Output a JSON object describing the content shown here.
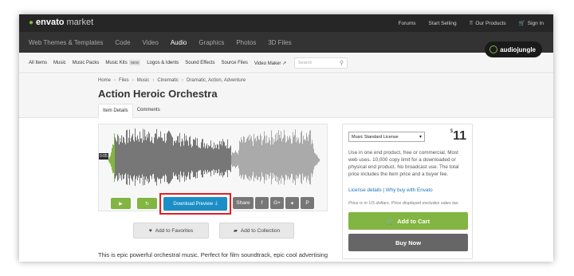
{
  "topbar": {
    "logo_brand": "envato",
    "logo_suffix": "market",
    "links": {
      "forums": "Forums",
      "start_selling": "Start Selling",
      "our_products": "Our Products",
      "sign_in": "Sign In"
    }
  },
  "navbar": {
    "items": [
      "Web Themes & Templates",
      "Code",
      "Video",
      "Audio",
      "Graphics",
      "Photos",
      "3D Files"
    ],
    "active": "Audio",
    "badge": "audiojungle"
  },
  "subnav": {
    "items": [
      "All Items",
      "Music",
      "Music Packs",
      "Music Kits",
      "Logos & Idents",
      "Sound Effects",
      "Source Files",
      "Video Maker"
    ],
    "new_badge": "NEW",
    "search_placeholder": "Search"
  },
  "title_area": {
    "breadcrumbs": [
      "Home",
      "Files",
      "Music",
      "Cinematic",
      "Dramatic, Action, Adventure"
    ],
    "title": "Action Heroic Orchestra",
    "tabs": [
      "Item Details",
      "Comments"
    ]
  },
  "player": {
    "timestamp": "0:05",
    "download_label": "Download Preview",
    "share_label": "Share",
    "social_icons": [
      "facebook-icon",
      "google-plus-icon",
      "twitter-icon",
      "pinterest-icon"
    ],
    "colors": {
      "green": "#82b541",
      "blue": "#1c8ec7",
      "highlight": "#e01f26"
    }
  },
  "actions": {
    "favorites": "Add to Favorites",
    "collection": "Add to Collection"
  },
  "description": "This is epic powerful orchestral music. Perfect for film soundtrack, epic cool advertising",
  "purchase": {
    "license": "Music Standard License",
    "currency": "$",
    "price": "11",
    "license_text": "Use in one end product, free or commercial. Most web uses. 10,000 copy limit for a downloaded or physical end product. No broadcast use. The total price includes the item price and a buyer fee.",
    "license_details": "License details",
    "separator": "|",
    "why_buy": "Why buy with Envato",
    "price_note": "Price is in US dollars. Price displayed excludes sales tax.",
    "add_to_cart": "Add to Cart",
    "buy_now": "Buy Now"
  }
}
